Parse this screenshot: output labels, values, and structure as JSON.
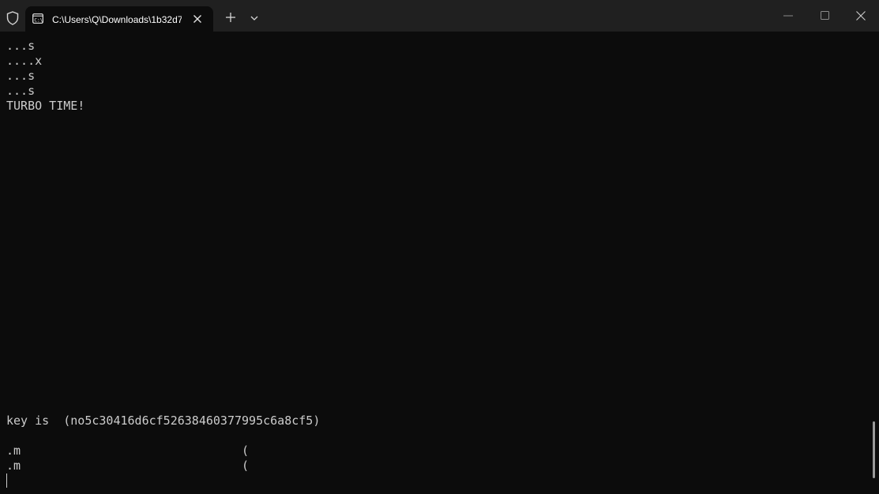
{
  "tab": {
    "title": "C:\\Users\\Q\\Downloads\\1b32d7",
    "icon": "terminal-icon"
  },
  "titlebar": {
    "security_icon": "shield-icon",
    "new_tab_icon": "plus-icon",
    "dropdown_icon": "chevron-down-icon",
    "controls": [
      "minimize-icon",
      "maximize-icon",
      "close-icon"
    ]
  },
  "terminal": {
    "lines": [
      "...s",
      "....x",
      "...s",
      "...s",
      "TURBO TIME!",
      "key is  (no5c30416d6cf52638460377995c6a8cf5)",
      ".m                               (",
      ".m                               ("
    ]
  },
  "colors": {
    "background": "#0c0c0c",
    "titlebar": "#202020",
    "text": "#cccccc"
  }
}
